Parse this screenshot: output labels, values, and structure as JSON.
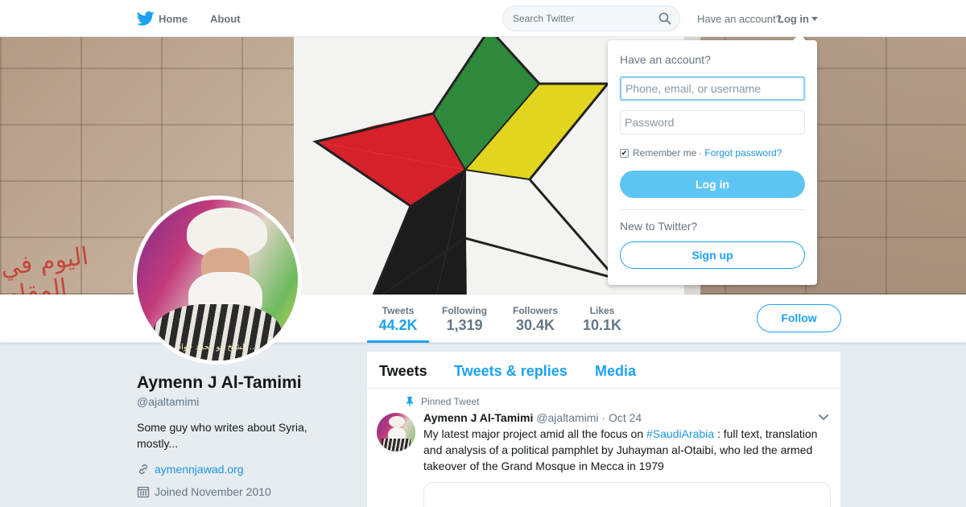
{
  "nav": {
    "home_label": "Home",
    "about_label": "About",
    "search_placeholder": "Search Twitter",
    "account_prompt": "Have an account?",
    "login_label": "Log in"
  },
  "profile": {
    "name": "Aymenn J Al-Tamimi",
    "handle": "@ajaltamimi",
    "bio": "Some guy who writes about Syria, mostly...",
    "website": "aymennjawad.org",
    "joined": "Joined November 2010",
    "avatar_caption": "الشيخ ابو محمد جواد ..."
  },
  "banner": {
    "arabic_text": "اليوم في المقام"
  },
  "stats": [
    {
      "label": "Tweets",
      "value": "44.2K"
    },
    {
      "label": "Following",
      "value": "1,319"
    },
    {
      "label": "Followers",
      "value": "30.4K"
    },
    {
      "label": "Likes",
      "value": "10.1K"
    }
  ],
  "follow_label": "Follow",
  "timeline": {
    "tabs": [
      "Tweets",
      "Tweets & replies",
      "Media"
    ],
    "pinned_label": "Pinned Tweet",
    "tweet": {
      "author": "Aymenn J Al-Tamimi",
      "handle": "@ajaltamimi",
      "date": "· Oct 24",
      "text_before": "My latest major project amid all the focus on ",
      "hashtag": "#SaudiArabia",
      "text_after": " : full text, translation and analysis of a political pamphlet by Juhayman al-Otaibi, who led the armed takeover of the Grand Mosque in Mecca in 1979"
    }
  },
  "login_dropdown": {
    "title": "Have an account?",
    "username_placeholder": "Phone, email, or username",
    "password_placeholder": "Password",
    "remember_label": "Remember me",
    "separator": "·",
    "forgot_label": "Forgot password?",
    "login_button": "Log in",
    "new_prompt": "New to Twitter?",
    "signup_button": "Sign up",
    "remember_checked": true
  },
  "colors": {
    "brand": "#1da1f2",
    "link": "#1b95e0",
    "background": "#e6ecf0",
    "star_green": "#2e8a3a",
    "star_yellow": "#e2d51f",
    "star_red": "#d6202a",
    "star_black": "#1c1c1c"
  },
  "icons": {
    "logo": "twitter-bird-icon",
    "search": "search-icon",
    "pin": "pin-icon",
    "link": "link-icon",
    "calendar": "calendar-icon",
    "chevron": "chevron-down-icon"
  }
}
